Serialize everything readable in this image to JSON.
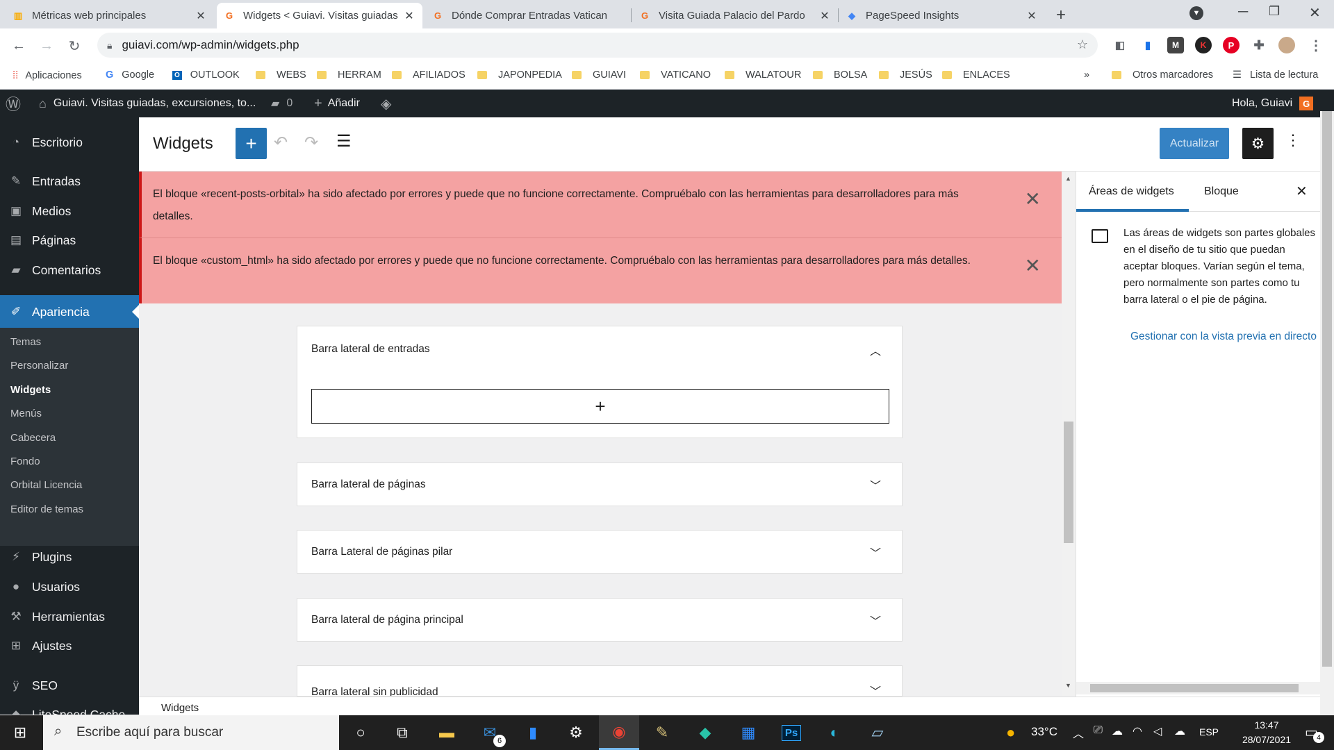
{
  "browser": {
    "tabs": [
      {
        "title": "Métricas web principales",
        "favicon": "analytics-icon",
        "color": "#f9ab00"
      },
      {
        "title": "Widgets < Guiavi. Visitas guiadas",
        "favicon": "guiavi-icon",
        "color": "#f26f21"
      },
      {
        "title": "Dónde Comprar Entradas Vaticano",
        "favicon": "guiavi-icon",
        "color": "#f26f21"
      },
      {
        "title": "Visita Guiada Palacio del Pardo",
        "favicon": "guiavi-icon",
        "color": "#f26f21"
      },
      {
        "title": "PageSpeed Insights",
        "favicon": "pagespeed-icon",
        "color": "#4285f4"
      }
    ],
    "url": "guiavi.com/wp-admin/widgets.php",
    "bookmarks": [
      "Aplicaciones",
      "Google",
      "OUTLOOK",
      "WEBS",
      "HERRAM",
      "AFILIADOS",
      "JAPONPEDIA",
      "GUIAVI",
      "VATICANO",
      "WALATOUR",
      "BOLSA",
      "JESÚS",
      "ENLACES"
    ],
    "bookmarks_more": "»",
    "other_bookmarks": "Otros marcadores",
    "reading_list": "Lista de lectura"
  },
  "adminbar": {
    "site_name": "Guiavi. Visitas guiadas, excursiones, to...",
    "comments_count": "0",
    "new_label": "Añadir",
    "greeting": "Hola, Guiavi"
  },
  "sidebar": {
    "items": [
      {
        "label": "Escritorio",
        "icon": "dashboard-icon"
      },
      {
        "label": "Entradas",
        "icon": "pin-icon"
      },
      {
        "label": "Medios",
        "icon": "media-icon"
      },
      {
        "label": "Páginas",
        "icon": "pages-icon"
      },
      {
        "label": "Comentarios",
        "icon": "comments-icon"
      },
      {
        "label": "Apariencia",
        "icon": "brush-icon"
      },
      {
        "label": "Plugins",
        "icon": "plugin-icon"
      },
      {
        "label": "Usuarios",
        "icon": "users-icon"
      },
      {
        "label": "Herramientas",
        "icon": "tools-icon"
      },
      {
        "label": "Ajustes",
        "icon": "settings-icon"
      },
      {
        "label": "SEO",
        "icon": "seo-icon"
      },
      {
        "label": "LiteSpeed Cache",
        "icon": "litespeed-icon"
      }
    ],
    "submenu": [
      "Temas",
      "Personalizar",
      "Widgets",
      "Menús",
      "Cabecera",
      "Fondo",
      "Orbital Licencia",
      "Editor de temas"
    ]
  },
  "editor": {
    "title": "Widgets",
    "update_button": "Actualizar",
    "notices": [
      "El bloque «recent-posts-orbital» ha sido afectado por errores y puede que no funcione correctamente. Compruébalo con las herramientas para desarrolladores para más detalles.",
      "El bloque «custom_html» ha sido afectado por errores y puede que no funcione correctamente. Compruébalo con las herramientas para desarrolladores para más detalles."
    ],
    "areas": [
      {
        "label": "Barra lateral de entradas",
        "expanded": true
      },
      {
        "label": "Barra lateral de páginas",
        "expanded": false
      },
      {
        "label": "Barra Lateral de páginas pilar",
        "expanded": false
      },
      {
        "label": "Barra lateral de página principal",
        "expanded": false
      },
      {
        "label": "Barra lateral sin publicidad",
        "expanded": false
      }
    ],
    "footer": "Widgets"
  },
  "inspector": {
    "tabs": [
      "Áreas de widgets",
      "Bloque"
    ],
    "description": "Las áreas de widgets son partes globales en el diseño de tu sitio que puedan aceptar bloques. Varían según el tema, pero normalmente son partes como tu barra lateral o el pie de página.",
    "link": "Gestionar con la vista previa en directo"
  },
  "taskbar": {
    "search_placeholder": "Escribe aquí para buscar",
    "mail_badge": "6",
    "temperature": "33°C",
    "language": "ESP",
    "time": "13:47",
    "date": "28/07/2021",
    "notif_count": "4"
  },
  "colors": {
    "wp_blue": "#2271b1",
    "admin_dark": "#1d2327",
    "notice_bg": "#f4a2a2",
    "update_btn": "#3582c4"
  }
}
